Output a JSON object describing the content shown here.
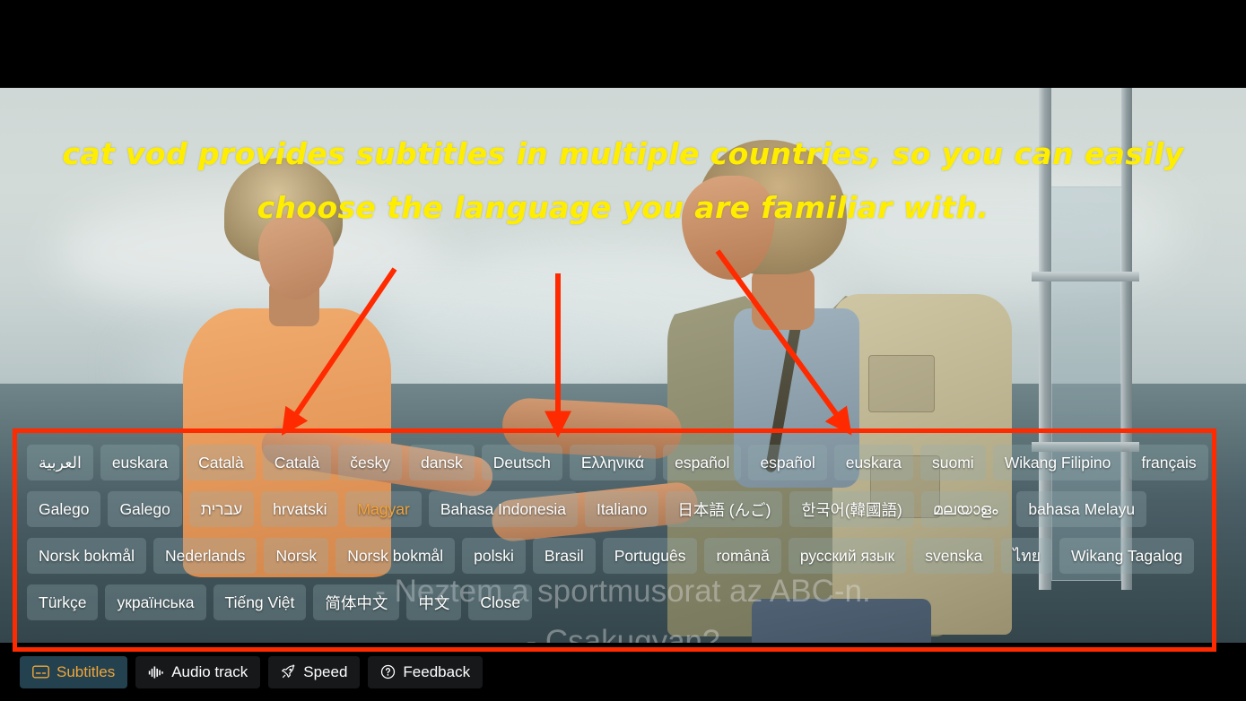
{
  "annotation": {
    "caption": "cat vod provides subtitles in multiple countries, so you can easily choose the language you are familiar with.",
    "highlight_color": "#ff2a00",
    "caption_color": "#ffee00"
  },
  "movie_subtitle": {
    "line1": "- Neztem a sportmusorat az ABC-n.",
    "line2": "- Csakugyan?"
  },
  "language_panel": {
    "selected": "Magyar",
    "selected_color": "#f2a33c",
    "rows": [
      [
        {
          "label": "العربية"
        },
        {
          "label": "euskara"
        },
        {
          "label": "Català"
        },
        {
          "label": "Català"
        },
        {
          "label": "česky"
        },
        {
          "label": "dansk"
        },
        {
          "label": "Deutsch"
        },
        {
          "label": "Ελληνικά"
        },
        {
          "label": "español"
        },
        {
          "label": "español"
        },
        {
          "label": "euskara"
        },
        {
          "label": "suomi"
        },
        {
          "label": "Wikang Filipino"
        },
        {
          "label": "français"
        }
      ],
      [
        {
          "label": "Galego"
        },
        {
          "label": "Galego"
        },
        {
          "label": "עברית"
        },
        {
          "label": "hrvatski"
        },
        {
          "label": "Magyar"
        },
        {
          "label": "Bahasa Indonesia"
        },
        {
          "label": "Italiano"
        },
        {
          "label": "日本語 (んご)"
        },
        {
          "label": "한국어(韓國語)"
        },
        {
          "label": "മലയാളം"
        },
        {
          "label": "bahasa Melayu"
        }
      ],
      [
        {
          "label": "Norsk bokmål"
        },
        {
          "label": "Nederlands"
        },
        {
          "label": "Norsk"
        },
        {
          "label": "Norsk bokmål"
        },
        {
          "label": "polski"
        },
        {
          "label": "Brasil"
        },
        {
          "label": "Português"
        },
        {
          "label": "română"
        },
        {
          "label": "русский язык"
        },
        {
          "label": "svenska"
        },
        {
          "label": "ไทย"
        },
        {
          "label": "Wikang Tagalog"
        }
      ],
      [
        {
          "label": "Türkçe"
        },
        {
          "label": "українська"
        },
        {
          "label": "Tiếng Việt"
        },
        {
          "label": "简体中文"
        },
        {
          "label": "中文"
        },
        {
          "label": "Close"
        }
      ]
    ]
  },
  "bottom_bar": {
    "buttons": [
      {
        "label": "Subtitles",
        "icon": "subtitles-icon",
        "active": true
      },
      {
        "label": "Audio track",
        "icon": "audio-track-icon",
        "active": false
      },
      {
        "label": "Speed",
        "icon": "rocket-icon",
        "active": false
      },
      {
        "label": "Feedback",
        "icon": "question-circle-icon",
        "active": false
      }
    ],
    "active_bg": "#24414f",
    "active_color": "#f0a63a"
  }
}
